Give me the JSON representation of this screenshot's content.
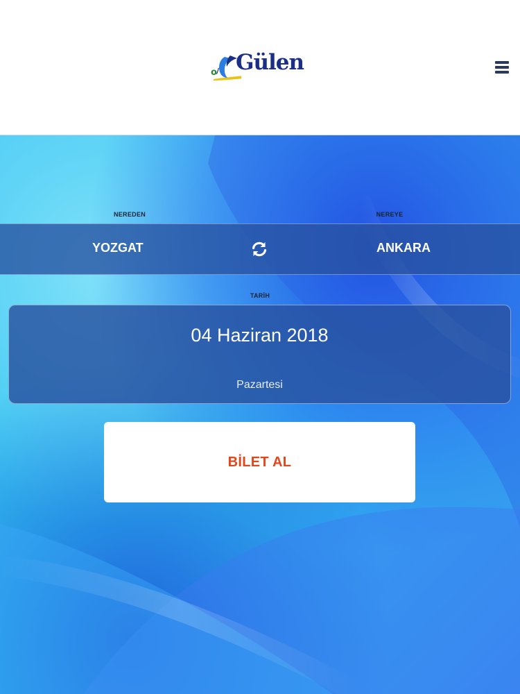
{
  "header": {
    "brand_name": "Gülen",
    "logo_icon": "gulen-logo",
    "menu_icon": "hamburger-menu-icon"
  },
  "search": {
    "from_label": "NEREDEN",
    "to_label": "NEREYE",
    "from_value": "YOZGAT",
    "to_value": "ANKARA",
    "swap_icon": "refresh-swap-icon",
    "date_label": "TARİH",
    "date_value": "04 Haziran 2018",
    "day_value": "Pazartesi"
  },
  "actions": {
    "buy_label": "BİLET AL"
  },
  "colors": {
    "brand_blue": "#1b2f86",
    "accent_orange": "#e2471c",
    "panel_blue": "#2852a0"
  }
}
